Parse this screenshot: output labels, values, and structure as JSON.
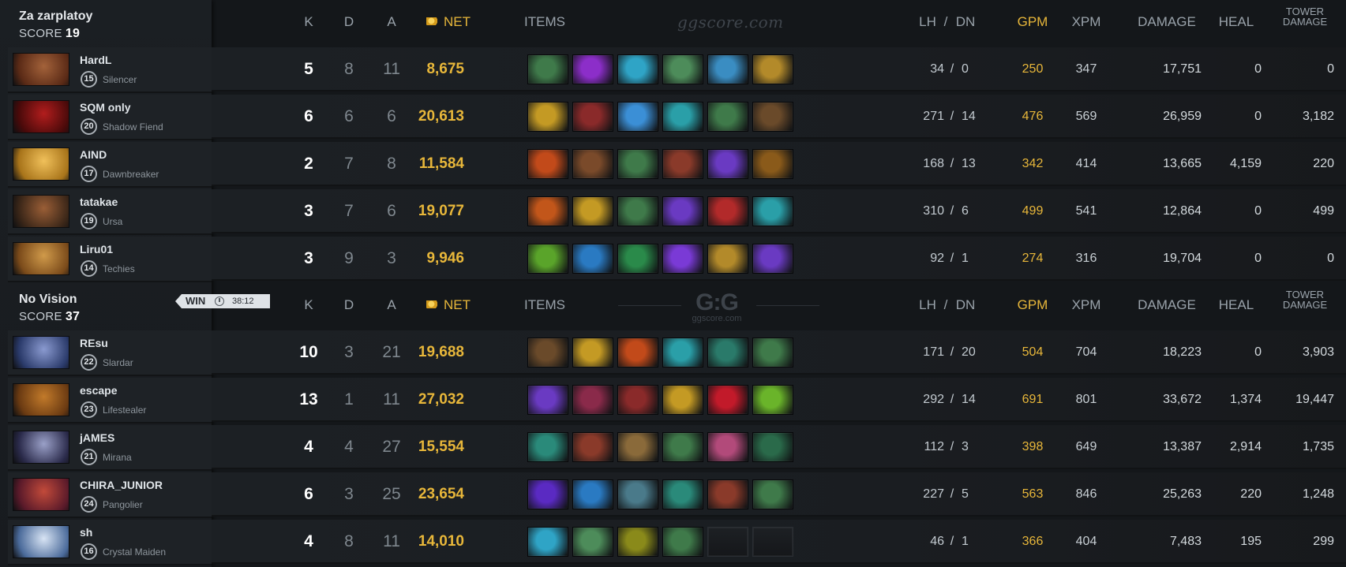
{
  "headers": {
    "k": "K",
    "d": "D",
    "a": "A",
    "net": "NET",
    "items": "ITEMS",
    "lh": "LH",
    "slash": "/",
    "dn": "DN",
    "gpm": "GPM",
    "xpm": "XPM",
    "damage": "DAMAGE",
    "heal": "HEAL",
    "tower1": "TOWER",
    "tower2": "DAMAGE"
  },
  "watermark1": "ggscore.com",
  "watermark2": {
    "big": "G:G",
    "small": "ggscore.com"
  },
  "colors": {
    "gold": "#e8b73a",
    "background": "#14171a",
    "panel": "#1e2226"
  },
  "result": {
    "label": "WIN",
    "time": "38:12",
    "clock_icon": "clock-icon"
  },
  "teams": [
    {
      "name": "Za zarplatoy",
      "score_label": "SCORE",
      "score": "19",
      "players": [
        {
          "name": "HardL",
          "level": "15",
          "hero": "Silencer",
          "hero_color": [
            "#5a2a16",
            "#a3623a"
          ],
          "k": "5",
          "d": "8",
          "a": "11",
          "net": "8,675",
          "lh": "34",
          "dn": "0",
          "gpm": "250",
          "xpm": "347",
          "damage": "17,751",
          "heal": "0",
          "tower": "0",
          "items": [
            "#3f7a4a",
            "#8c2ec9",
            "#2fa4c6",
            "#4d8c5a",
            "#3a8dc2",
            "#b38a2a"
          ]
        },
        {
          "name": "SQM only",
          "level": "20",
          "hero": "Shadow Fiend",
          "hero_color": [
            "#4a0a0a",
            "#b21d1d"
          ],
          "k": "6",
          "d": "6",
          "a": "6",
          "net": "20,613",
          "lh": "271",
          "dn": "14",
          "gpm": "476",
          "xpm": "569",
          "damage": "26,959",
          "heal": "0",
          "tower": "3,182",
          "items": [
            "#c49a24",
            "#8a2a2a",
            "#3b8fd6",
            "#2a9fa8",
            "#3f7a4a",
            "#6a4a2a"
          ]
        },
        {
          "name": "AIND",
          "level": "17",
          "hero": "Dawnbreaker",
          "hero_color": [
            "#a8741a",
            "#f0c05a"
          ],
          "k": "2",
          "d": "7",
          "a": "8",
          "net": "11,584",
          "lh": "168",
          "dn": "13",
          "gpm": "342",
          "xpm": "414",
          "damage": "13,665",
          "heal": "4,159",
          "tower": "220",
          "items": [
            "#c24a1a",
            "#7a4a2a",
            "#3f7a4a",
            "#8a3a2a",
            "#6a3ac2",
            "#8a5a1a"
          ]
        },
        {
          "name": "tatakae",
          "level": "19",
          "hero": "Ursa",
          "hero_color": [
            "#3a2618",
            "#9a5e36"
          ],
          "k": "3",
          "d": "7",
          "a": "6",
          "net": "19,077",
          "lh": "310",
          "dn": "6",
          "gpm": "499",
          "xpm": "541",
          "damage": "12,864",
          "heal": "0",
          "tower": "499",
          "items": [
            "#c2561a",
            "#c49a24",
            "#3f7a4a",
            "#6a3ac2",
            "#b22a2a",
            "#2a9fa8"
          ]
        },
        {
          "name": "Liru01",
          "level": "14",
          "hero": "Techies",
          "hero_color": [
            "#7a4a1a",
            "#d09a4a"
          ],
          "k": "3",
          "d": "9",
          "a": "3",
          "net": "9,946",
          "lh": "92",
          "dn": "1",
          "gpm": "274",
          "xpm": "316",
          "damage": "19,704",
          "heal": "0",
          "tower": "0",
          "items": [
            "#5aa42a",
            "#2a7ac2",
            "#2a8a4a",
            "#7a3ad6",
            "#b38a2a",
            "#6a3ac2"
          ]
        }
      ]
    },
    {
      "name": "No Vision",
      "score_label": "SCORE",
      "score": "37",
      "players": [
        {
          "name": "REsu",
          "level": "22",
          "hero": "Slardar",
          "hero_color": [
            "#2a3a6a",
            "#8a9ad0"
          ],
          "k": "10",
          "d": "3",
          "a": "21",
          "net": "19,688",
          "lh": "171",
          "dn": "20",
          "gpm": "504",
          "xpm": "704",
          "damage": "18,223",
          "heal": "0",
          "tower": "3,903",
          "items": [
            "#6a4a2a",
            "#c49a24",
            "#c24a1a",
            "#2a9fa8",
            "#2a7a6a",
            "#3f7a4a"
          ]
        },
        {
          "name": "escape",
          "level": "23",
          "hero": "Lifestealer",
          "hero_color": [
            "#6a3a12",
            "#c27a2a"
          ],
          "k": "13",
          "d": "1",
          "a": "11",
          "net": "27,032",
          "lh": "292",
          "dn": "14",
          "gpm": "691",
          "xpm": "801",
          "damage": "33,672",
          "heal": "1,374",
          "tower": "19,447",
          "items": [
            "#6a3ac2",
            "#8a2a4a",
            "#8a2a2a",
            "#c49a24",
            "#c21a2a",
            "#6ab42a"
          ]
        },
        {
          "name": "jAMES",
          "level": "21",
          "hero": "Mirana",
          "hero_color": [
            "#2a2a4a",
            "#9aa0c8"
          ],
          "k": "4",
          "d": "4",
          "a": "27",
          "net": "15,554",
          "lh": "112",
          "dn": "3",
          "gpm": "398",
          "xpm": "649",
          "damage": "13,387",
          "heal": "2,914",
          "tower": "1,735",
          "items": [
            "#2a8a7a",
            "#8a3a2a",
            "#8a6a3a",
            "#3f7a4a",
            "#b24a7a",
            "#2a6a4a"
          ]
        },
        {
          "name": "CHIRA_JUNIOR",
          "level": "24",
          "hero": "Pangolier",
          "hero_color": [
            "#5a1a2a",
            "#c24a3a"
          ],
          "k": "6",
          "d": "3",
          "a": "25",
          "net": "23,654",
          "lh": "227",
          "dn": "5",
          "gpm": "563",
          "xpm": "846",
          "damage": "25,263",
          "heal": "220",
          "tower": "1,248",
          "items": [
            "#5a2ac2",
            "#2a7ac2",
            "#4a7a8a",
            "#2a8a7a",
            "#8a3a2a",
            "#3f7a4a"
          ]
        },
        {
          "name": "sh",
          "level": "16",
          "hero": "Crystal Maiden",
          "hero_color": [
            "#4a6a9a",
            "#d8e4f4"
          ],
          "k": "4",
          "d": "8",
          "a": "11",
          "net": "14,010",
          "lh": "46",
          "dn": "1",
          "gpm": "366",
          "xpm": "404",
          "damage": "7,483",
          "heal": "195",
          "tower": "299",
          "items": [
            "#2fa4c6",
            "#4d8c5a",
            "#8a8a1a",
            "#3f7a4a",
            "empty",
            "empty"
          ]
        }
      ]
    }
  ]
}
